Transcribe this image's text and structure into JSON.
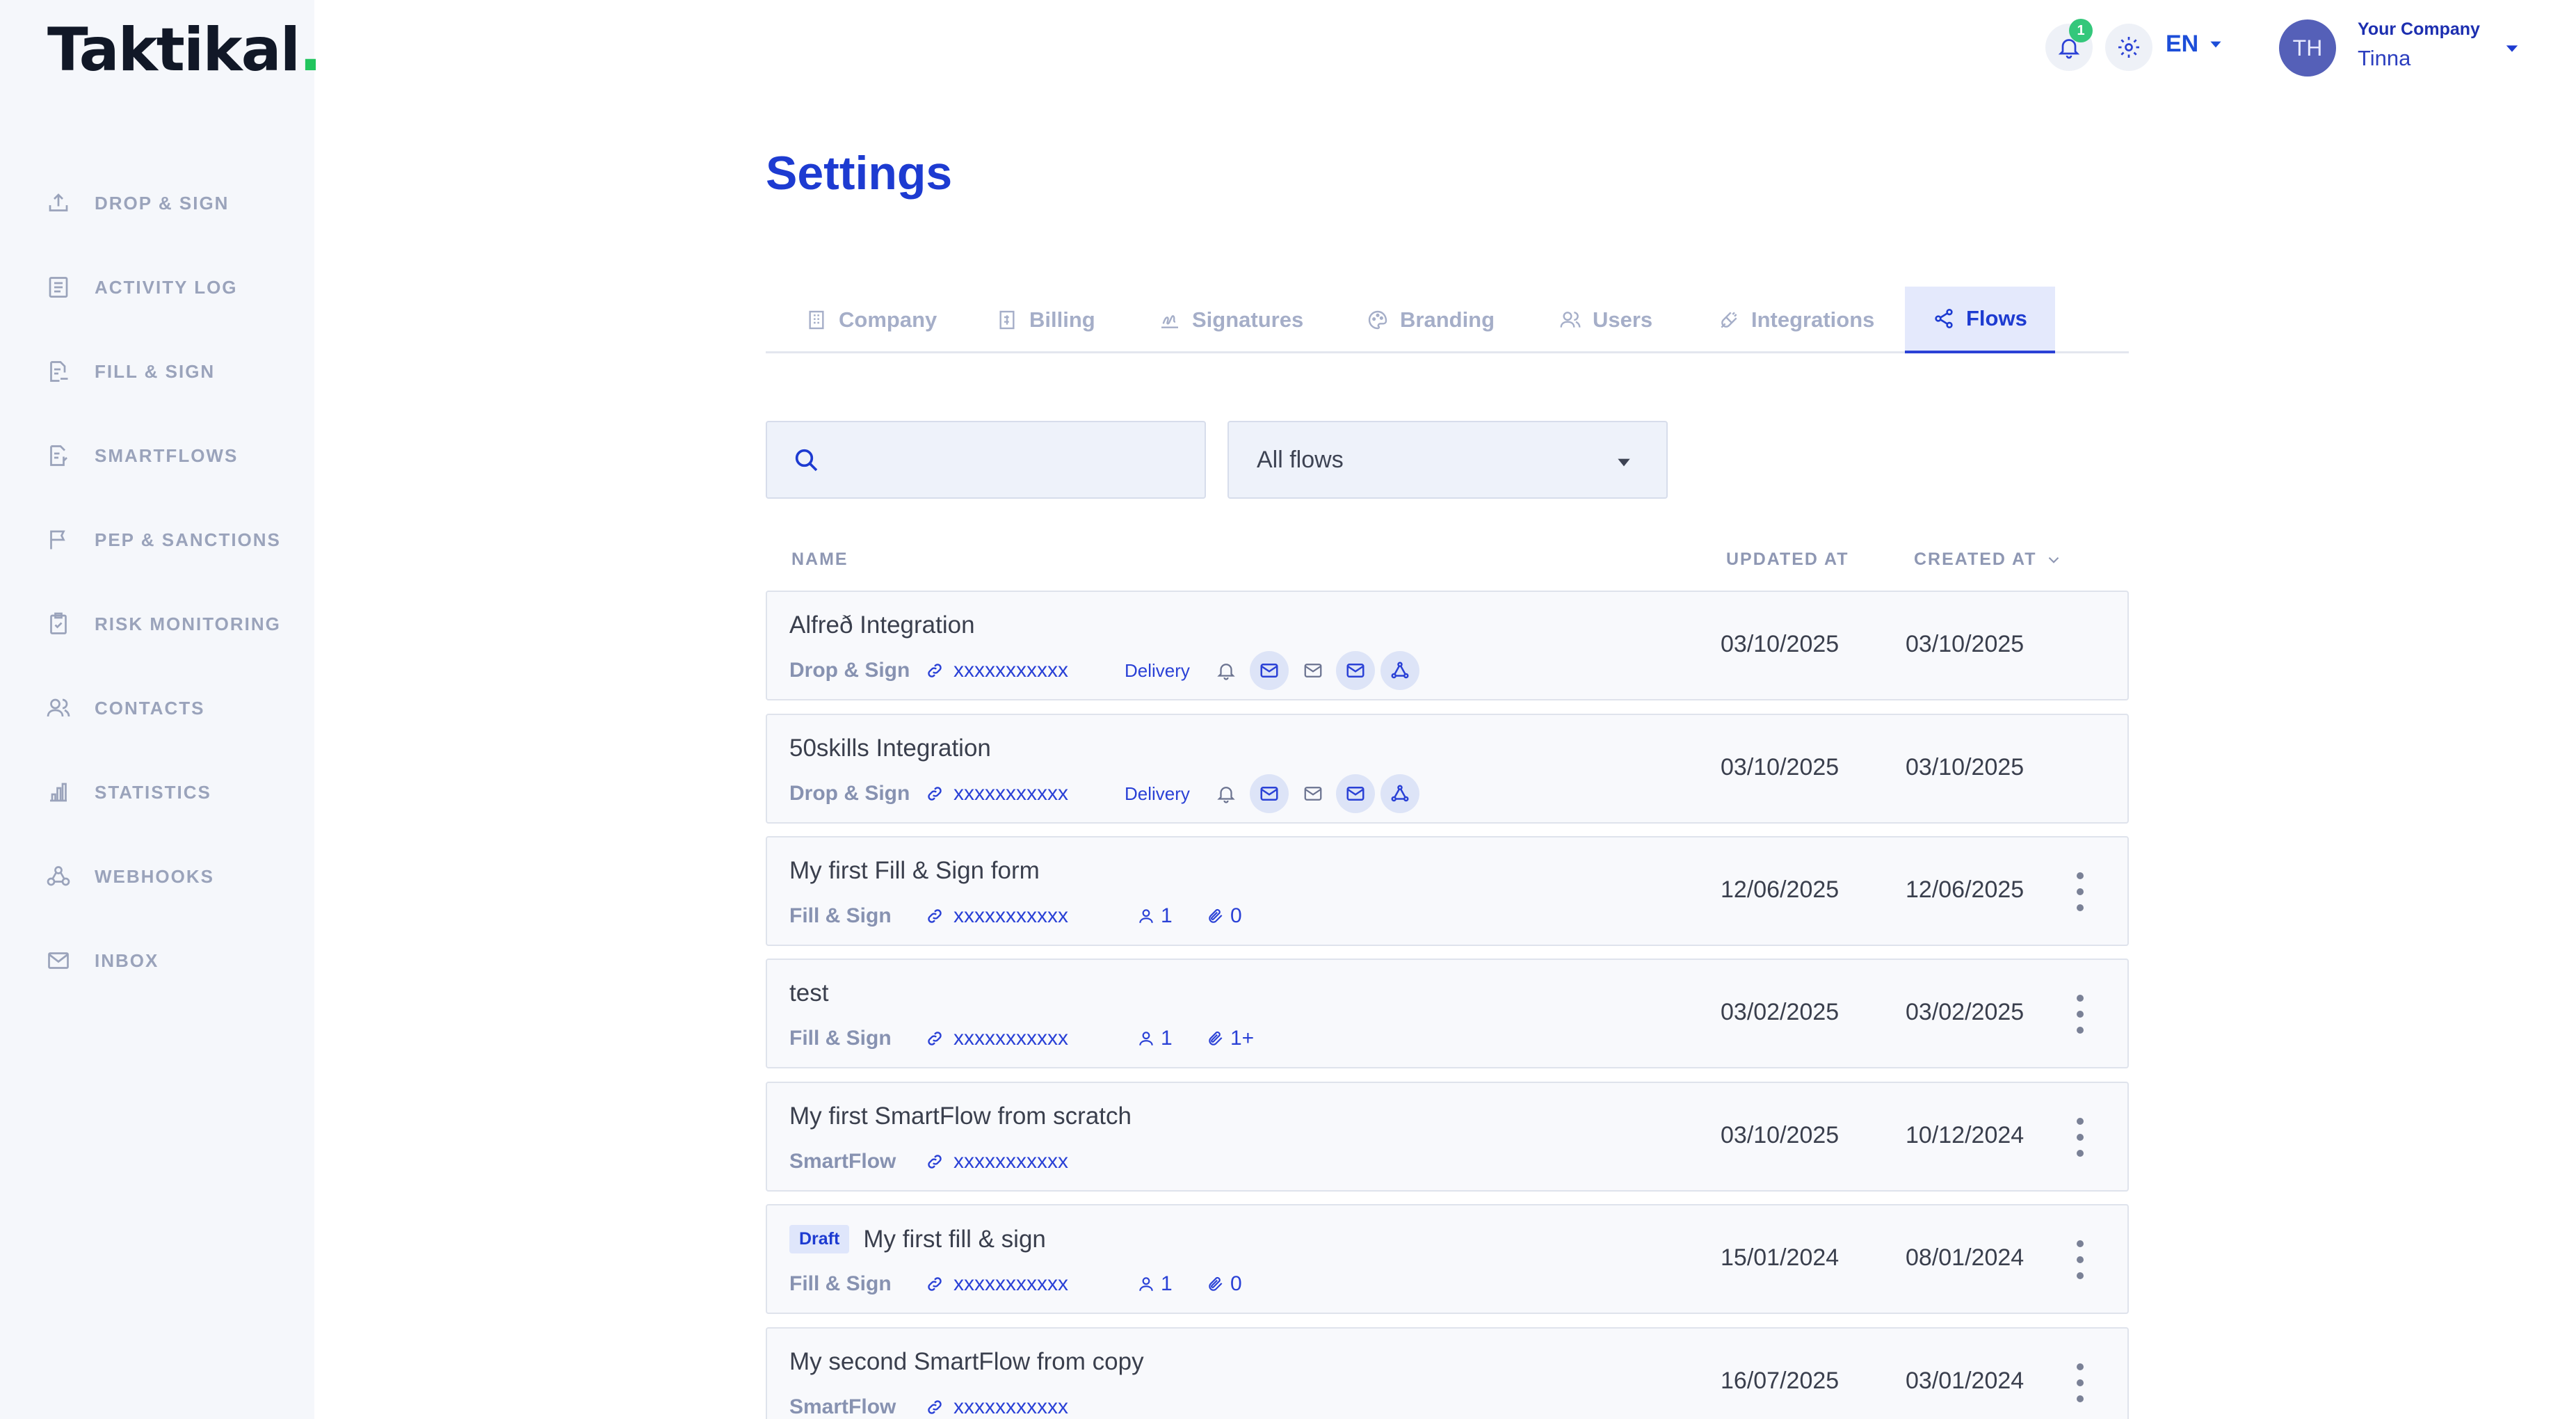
{
  "app": {
    "logo_text": "Taktikal",
    "logo_dot": "."
  },
  "sidebar": {
    "items": [
      {
        "label": "DROP & SIGN",
        "icon": "upload-icon"
      },
      {
        "label": "ACTIVITY LOG",
        "icon": "list-icon"
      },
      {
        "label": "FILL & SIGN",
        "icon": "form-sign-icon"
      },
      {
        "label": "SMARTFLOWS",
        "icon": "smartflow-icon"
      },
      {
        "label": "PEP & SANCTIONS",
        "icon": "flag-icon"
      },
      {
        "label": "RISK MONITORING",
        "icon": "clipboard-icon"
      },
      {
        "label": "CONTACTS",
        "icon": "contacts-icon"
      },
      {
        "label": "STATISTICS",
        "icon": "chart-icon"
      },
      {
        "label": "WEBHOOKS",
        "icon": "webhook-icon"
      },
      {
        "label": "INBOX",
        "icon": "mail-icon"
      }
    ]
  },
  "topbar": {
    "notification_count": "1",
    "language": "EN",
    "avatar_initials": "TH",
    "company": "Your Company",
    "user_name": "Tinna"
  },
  "page": {
    "title": "Settings"
  },
  "tabs": [
    {
      "label": "Company",
      "icon": "building-icon"
    },
    {
      "label": "Billing",
      "icon": "invoice-icon"
    },
    {
      "label": "Signatures",
      "icon": "signature-icon"
    },
    {
      "label": "Branding",
      "icon": "palette-icon"
    },
    {
      "label": "Users",
      "icon": "users-icon"
    },
    {
      "label": "Integrations",
      "icon": "plug-icon"
    },
    {
      "label": "Flows",
      "icon": "share-icon",
      "active": true
    }
  ],
  "search": {
    "placeholder": ""
  },
  "filter": {
    "selected": "All flows"
  },
  "table": {
    "columns": {
      "name": "NAME",
      "updated": "UPDATED AT",
      "created": "CREATED AT"
    },
    "rows": [
      {
        "name": "Alfreð Integration",
        "draft": false,
        "type": "Drop & Sign",
        "link": "xxxxxxxxxxx",
        "delivery": "Delivery",
        "updated": "03/10/2025",
        "created": "03/10/2025"
      },
      {
        "name": "50skills Integration",
        "draft": false,
        "type": "Drop & Sign",
        "link": "xxxxxxxxxxx",
        "delivery": "Delivery",
        "updated": "03/10/2025",
        "created": "03/10/2025"
      },
      {
        "name": "My first Fill & Sign form",
        "draft": false,
        "type": "Fill & Sign",
        "link": "xxxxxxxxxxx",
        "signers": "1",
        "attachments": "0",
        "updated": "12/06/2025",
        "created": "12/06/2025"
      },
      {
        "name": "test",
        "draft": false,
        "type": "Fill & Sign",
        "link": "xxxxxxxxxxx",
        "signers": "1",
        "attachments": "1+",
        "updated": "03/02/2025",
        "created": "03/02/2025"
      },
      {
        "name": "My first SmartFlow from scratch",
        "draft": false,
        "type": "SmartFlow",
        "link": "xxxxxxxxxxx",
        "updated": "03/10/2025",
        "created": "10/12/2024"
      },
      {
        "name": "My first fill & sign",
        "draft_label": "Draft",
        "type": "Fill & Sign",
        "link": "xxxxxxxxxxx",
        "signers": "1",
        "attachments": "0",
        "updated": "15/01/2024",
        "created": "08/01/2024"
      },
      {
        "name": "My second SmartFlow from copy",
        "draft": false,
        "type": "SmartFlow",
        "link": "xxxxxxxxxxx",
        "updated": "16/07/2025",
        "created": "03/01/2024"
      }
    ]
  },
  "colors": {
    "accent": "#1d3bd1",
    "sidebar_bg": "#f5f7fb",
    "badge": "#34c77b"
  }
}
